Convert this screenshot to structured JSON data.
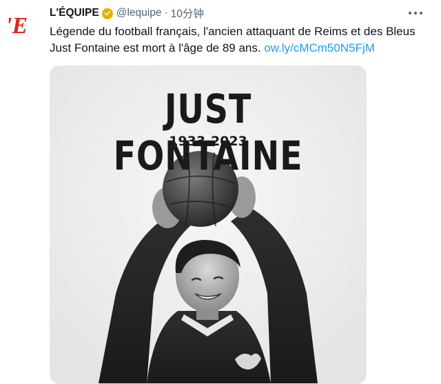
{
  "tweet": {
    "author_name": "L'ÉQUIPE",
    "handle": "@lequipe",
    "separator": "·",
    "time": "10分钟",
    "avatar_letter": "'E",
    "text": "Légende du football français, l'ancien attaquant de Reims et des Bleus Just Fontaine est mort à l'âge de 89 ans. ",
    "link_text": "ow.ly/cMCm50N5FjM"
  },
  "media": {
    "headline": "JUST FONTAINE",
    "years": "1933-2023"
  },
  "colors": {
    "accent": "#1d9bf0",
    "brand_red": "#e2231a",
    "verified_gold": "#e8b000"
  },
  "icons": {
    "verified": "verified-badge-icon",
    "more": "more-options-icon"
  }
}
